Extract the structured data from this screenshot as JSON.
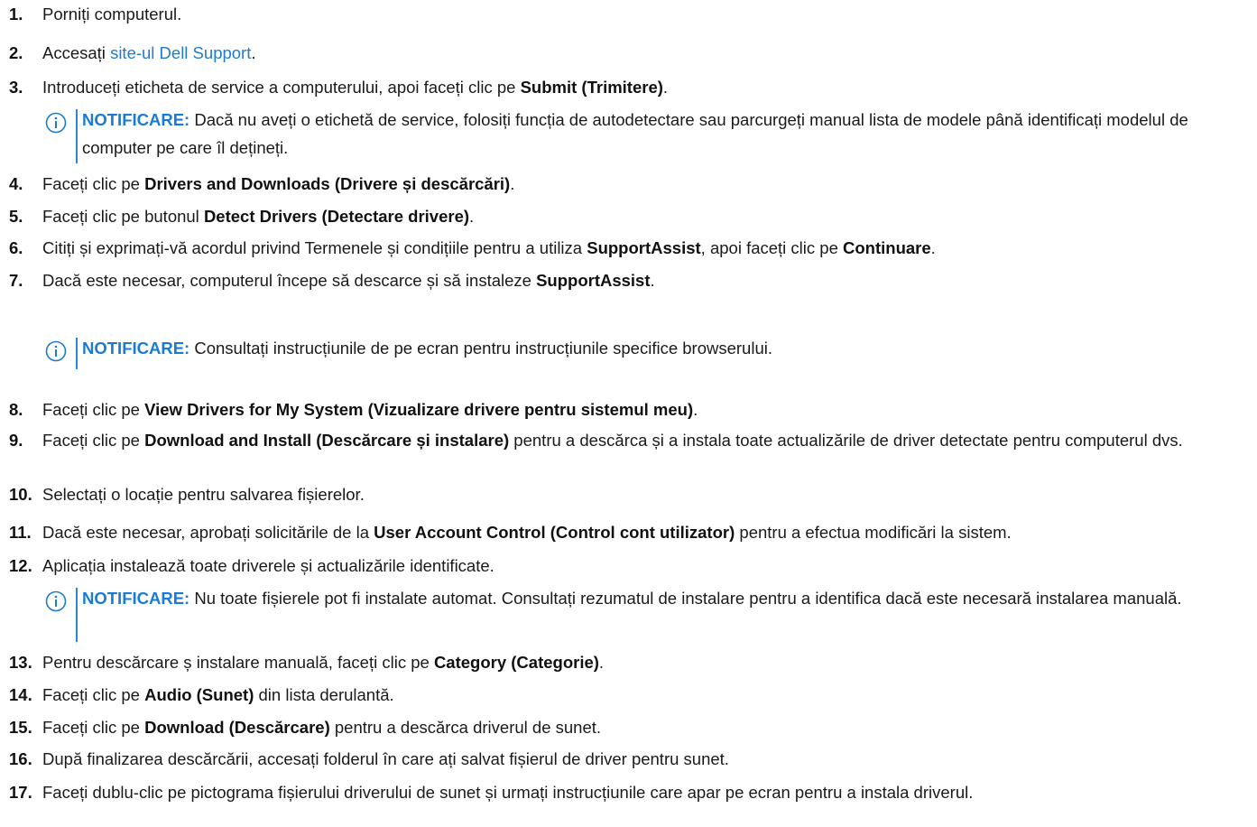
{
  "steps": [
    {
      "n": "1.",
      "parts": [
        {
          "t": "Porniți computerul."
        }
      ]
    },
    {
      "n": "2.",
      "parts": [
        {
          "t": "Accesați "
        },
        {
          "t": "site-ul Dell Support",
          "link": true
        },
        {
          "t": "."
        }
      ]
    },
    {
      "n": "3.",
      "parts": [
        {
          "t": "Introduceți eticheta de service a computerului, apoi faceți clic pe "
        },
        {
          "t": "Submit (Trimitere)",
          "b": true
        },
        {
          "t": "."
        }
      ]
    },
    {
      "n": "4.",
      "parts": [
        {
          "t": "Faceți clic pe "
        },
        {
          "t": "Drivers and Downloads (Drivere și descărcări)",
          "b": true
        },
        {
          "t": "."
        }
      ]
    },
    {
      "n": "5.",
      "parts": [
        {
          "t": "Faceți clic pe butonul "
        },
        {
          "t": "Detect Drivers (Detectare drivere)",
          "b": true
        },
        {
          "t": "."
        }
      ]
    },
    {
      "n": "6.",
      "parts": [
        {
          "t": "Citiți și exprimați-vă acordul privind Termenele și condițiile pentru a utiliza "
        },
        {
          "t": "SupportAssist",
          "b": true
        },
        {
          "t": ", apoi faceți clic pe "
        },
        {
          "t": "Continuare",
          "b": true
        },
        {
          "t": "."
        }
      ]
    },
    {
      "n": "7.",
      "parts": [
        {
          "t": "Dacă este necesar, computerul începe să descarce și să instaleze "
        },
        {
          "t": "SupportAssist",
          "b": true
        },
        {
          "t": "."
        }
      ]
    },
    {
      "n": "8.",
      "parts": [
        {
          "t": "Faceți clic pe "
        },
        {
          "t": "View Drivers for My System (Vizualizare drivere pentru sistemul meu)",
          "b": true
        },
        {
          "t": "."
        }
      ]
    },
    {
      "n": "9.",
      "parts": [
        {
          "t": "Faceți clic pe "
        },
        {
          "t": "Download and Install (Descărcare și instalare)",
          "b": true
        },
        {
          "t": " pentru a descărca și a instala toate actualizările de driver detectate pentru computerul dvs."
        }
      ]
    },
    {
      "n": "10.",
      "parts": [
        {
          "t": "Selectați o locație pentru salvarea fișierelor."
        }
      ]
    },
    {
      "n": "11.",
      "parts": [
        {
          "t": "Dacă este necesar, aprobați solicitările de la "
        },
        {
          "t": "User Account Control (Control cont utilizator)",
          "b": true
        },
        {
          "t": " pentru a efectua modificări la sistem."
        }
      ]
    },
    {
      "n": "12.",
      "parts": [
        {
          "t": "Aplicația instalează toate driverele și actualizările identificate."
        }
      ]
    },
    {
      "n": "13.",
      "parts": [
        {
          "t": "Pentru descărcare ș instalare manuală, faceți clic pe "
        },
        {
          "t": "Category (Categorie)",
          "b": true
        },
        {
          "t": "."
        }
      ]
    },
    {
      "n": "14.",
      "parts": [
        {
          "t": "Faceți clic pe "
        },
        {
          "t": "Audio (Sunet)",
          "b": true
        },
        {
          "t": " din lista derulantă."
        }
      ]
    },
    {
      "n": "15.",
      "parts": [
        {
          "t": "Faceți clic pe "
        },
        {
          "t": "Download (Descărcare)",
          "b": true
        },
        {
          "t": " pentru a descărca driverul de sunet."
        }
      ]
    },
    {
      "n": "16.",
      "parts": [
        {
          "t": "După finalizarea descărcării, accesați folderul în care ați salvat fișierul de driver pentru sunet."
        }
      ]
    },
    {
      "n": "17.",
      "parts": [
        {
          "t": "Faceți dublu-clic pe pictograma fișierului driverului de sunet și urmați instrucțiunile care apar pe ecran pentru a instala driverul."
        }
      ]
    }
  ],
  "notes": [
    {
      "label": "NOTIFICARE:",
      "text": " Dacă nu aveți o etichetă de service, folosiți funcția de autodetectare sau parcurgeți manual lista de modele până identificați modelul de computer pe care îl dețineți."
    },
    {
      "label": "NOTIFICARE:",
      "text": " Consultați instrucțiunile de pe ecran pentru instrucțiunile specifice browserului."
    },
    {
      "label": "NOTIFICARE:",
      "text": " Nu toate fișierele pot fi instalate automat. Consultați rezumatul de instalare pentru a identifica dacă este necesară instalarea manuală."
    }
  ],
  "colors": {
    "accent": "#1a7bd6",
    "link": "#1f7ad1",
    "text": "#1a1a1a"
  },
  "icon": "info-circle-icon"
}
